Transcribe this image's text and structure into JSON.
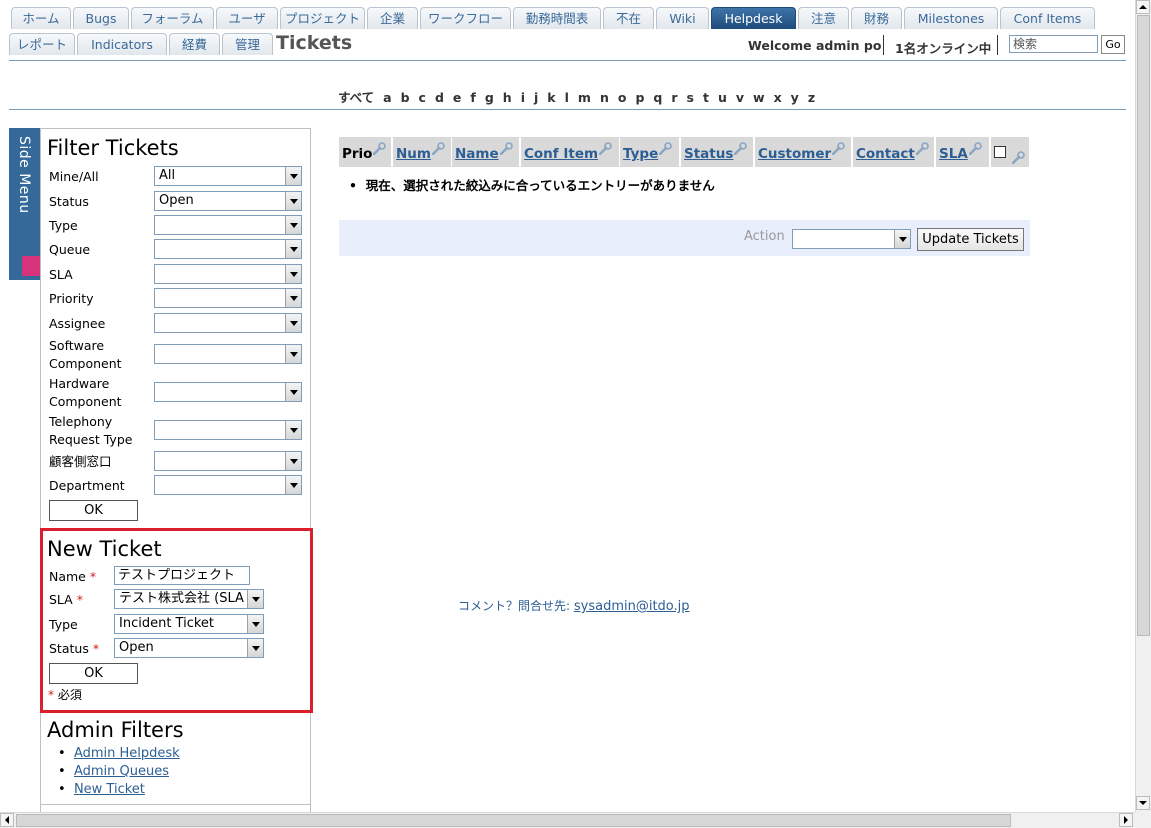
{
  "nav": {
    "tabs_row1": [
      "ホーム",
      "Bugs",
      "フォーラム",
      "ユーザ",
      "プロジェクト",
      "企業",
      "ワークフロー",
      "勤務時間表",
      "不在",
      "Wiki",
      "Helpdesk",
      "注意",
      "財務",
      "Milestones",
      "Conf Items"
    ],
    "tabs_row2": [
      "レポート",
      "Indicators",
      "経費",
      "管理"
    ],
    "active_tab": "Helpdesk"
  },
  "header": {
    "page_title": "Tickets",
    "welcome": "Welcome admin po",
    "online": "1名オンライン中",
    "search_placeholder": "検索",
    "go_label": "Go"
  },
  "letters": [
    "すべて",
    "a",
    "b",
    "c",
    "d",
    "e",
    "f",
    "g",
    "h",
    "i",
    "j",
    "k",
    "l",
    "m",
    "n",
    "o",
    "p",
    "q",
    "r",
    "s",
    "t",
    "u",
    "v",
    "w",
    "x",
    "y",
    "z"
  ],
  "sidemenu": {
    "label": "Side Menu"
  },
  "filter": {
    "title": "Filter Tickets",
    "fields": [
      {
        "label": "Mine/All",
        "value": "All"
      },
      {
        "label": "Status",
        "value": "Open"
      },
      {
        "label": "Type",
        "value": ""
      },
      {
        "label": "Queue",
        "value": ""
      },
      {
        "label": "SLA",
        "value": ""
      },
      {
        "label": "Priority",
        "value": ""
      },
      {
        "label": "Assignee",
        "value": ""
      },
      {
        "label": "Software\nComponent",
        "value": ""
      },
      {
        "label": "Hardware\nComponent",
        "value": ""
      },
      {
        "label": "Telephony\nRequest Type",
        "value": ""
      },
      {
        "label": "顧客側窓口",
        "value": ""
      },
      {
        "label": "Department",
        "value": ""
      }
    ],
    "ok_label": "OK"
  },
  "new_ticket": {
    "title": "New Ticket",
    "name_label": "Name",
    "name_value": "テストプロジェクト",
    "sla_label": "SLA",
    "sla_value": "テスト株式会社 (SLA",
    "type_label": "Type",
    "type_value": "Incident Ticket",
    "status_label": "Status",
    "status_value": "Open",
    "required_mark": "*",
    "ok_label": "OK",
    "required_note": "必須"
  },
  "admin_filters": {
    "title": "Admin Filters",
    "links": [
      "Admin Helpdesk",
      "Admin Queues",
      "New Ticket"
    ]
  },
  "table": {
    "columns": [
      "Prio",
      "Num",
      "Name",
      "Conf Item",
      "Type",
      "Status",
      "Customer",
      "Contact",
      "SLA"
    ],
    "empty_message": "現在、選択された絞込みに合っているエントリーがありません"
  },
  "actions": {
    "action_label": "Action",
    "action_value": "",
    "update_label": "Update Tickets"
  },
  "footer": {
    "contact_text": "コメント？問合せ先:",
    "contact_email": "sysadmin@itdo.jp"
  }
}
